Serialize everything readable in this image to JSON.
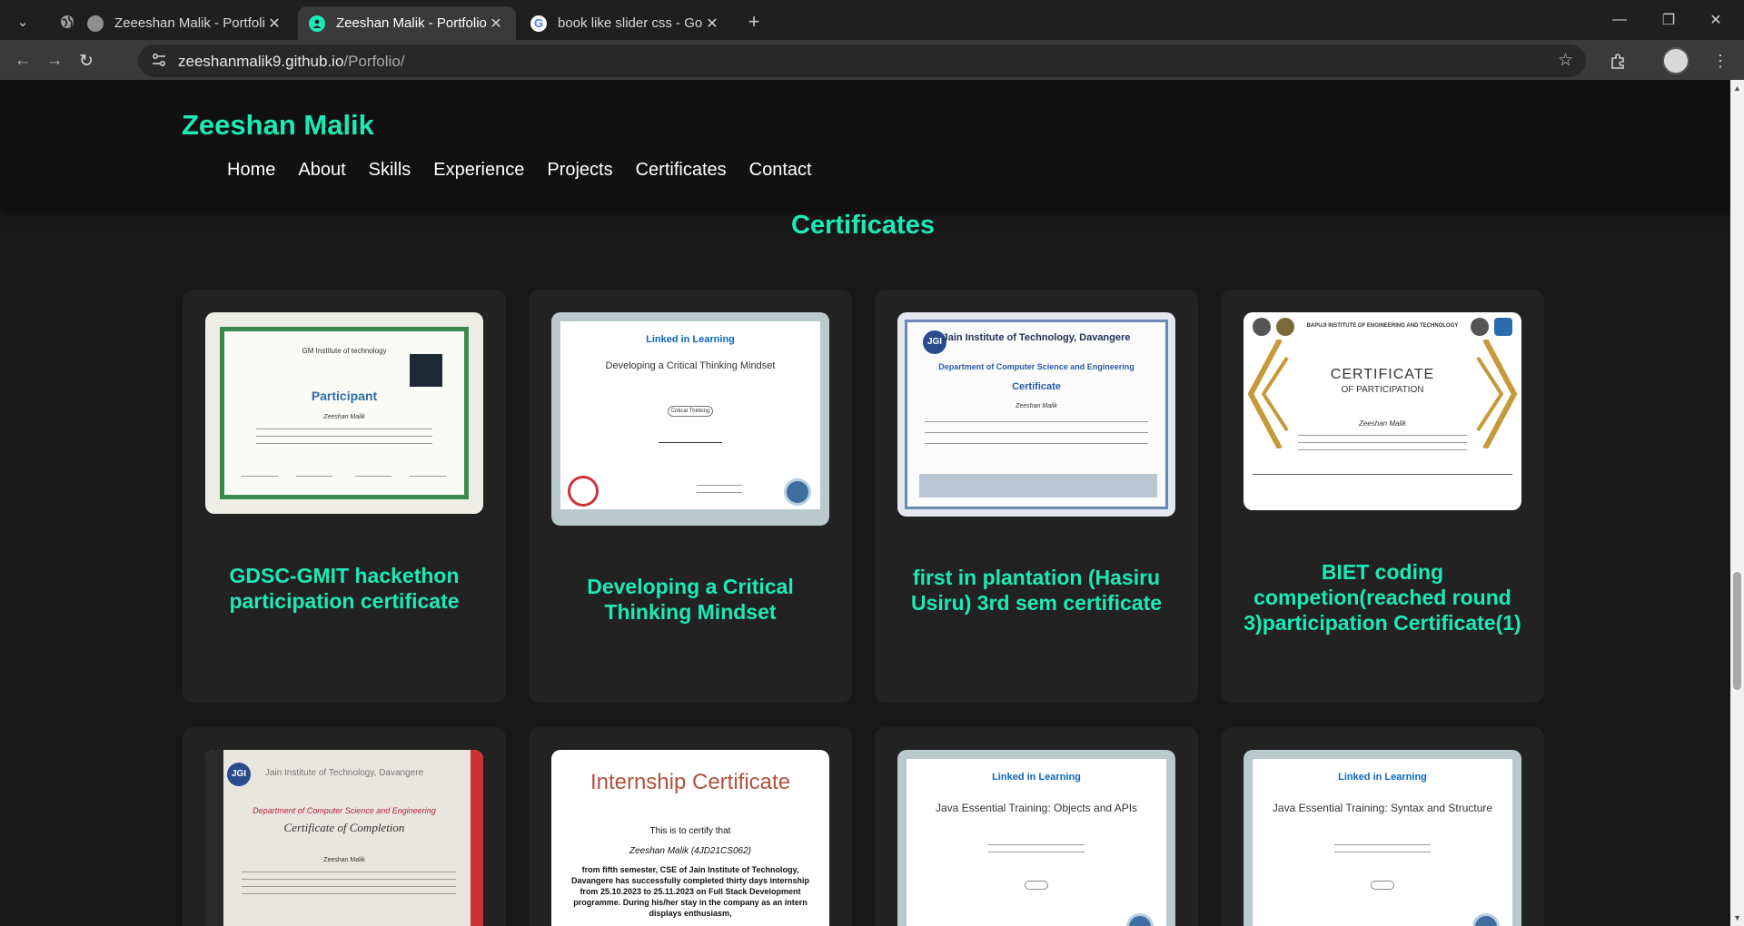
{
  "browser": {
    "tabs": [
      {
        "title": "Zeeeshan Malik - Portfolio",
        "active": false
      },
      {
        "title": "Zeeshan Malik - Portfolio",
        "active": true
      },
      {
        "title": "book like slider css - Google Se",
        "active": false
      }
    ],
    "new_tab_icon": "plus-icon",
    "url_host": "zeeshanmalik9.github.io",
    "url_path": "/Porfolio/"
  },
  "site": {
    "brand": "Zeeshan Malik",
    "nav": [
      "Home",
      "About",
      "Skills",
      "Experience",
      "Projects",
      "Certificates",
      "Contact"
    ],
    "section_title": "Certificates",
    "accent_color": "#1de9b6"
  },
  "certificates": [
    {
      "caption": "GDSC-GMIT hackethon participation certificate",
      "thumb": {
        "heading": "GM Institute of technology",
        "title": "Participant",
        "name": "Zeeshan Malik"
      }
    },
    {
      "caption": "Developing a Critical Thinking Mindset",
      "thumb": {
        "brand": "Linked in Learning",
        "title": "Developing a Critical Thinking Mindset",
        "skill": "Critical Thinking"
      }
    },
    {
      "caption": "first in plantation (Hasiru Usiru) 3rd sem certificate",
      "thumb": {
        "institute": "Jain Institute of Technology, Davangere",
        "dept": "Department of Computer Science and Engineering",
        "title": "Certificate",
        "name": "Zeeshan Malik"
      }
    },
    {
      "caption": "BIET coding competion(reached round 3)participation Certificate(1)",
      "thumb": {
        "institute": "BAPUJI INSTITUTE OF ENGINEERING AND TECHNOLOGY",
        "title": "CERTIFICATE",
        "subtitle": "OF PARTICIPATION",
        "name": "Zeeshan Malik"
      }
    },
    {
      "caption": "",
      "thumb": {
        "institute": "Jain Institute of Technology, Davangere",
        "dept": "Department of Computer Science and Engineering",
        "title": "Certificate of Completion",
        "name": "Zeeshan Malik"
      }
    },
    {
      "caption": "",
      "thumb": {
        "title": "Internship Certificate",
        "certify": "This is to certify that",
        "name": "Zeeshan Malik (4JD21CS062)",
        "body": "from fifth semester, CSE of Jain Institute of Technology, Davangere has successfully completed thirty days internship from 25.10.2023 to 25.11.2023 on Full Stack Development programme. During his/her stay in the company as an intern displays enthusiasm,"
      }
    },
    {
      "caption": "",
      "thumb": {
        "brand": "Linked in Learning",
        "title": "Java Essential Training: Objects and APIs"
      }
    },
    {
      "caption": "",
      "thumb": {
        "brand": "Linked in Learning",
        "title": "Java Essential Training: Syntax and Structure"
      }
    }
  ]
}
